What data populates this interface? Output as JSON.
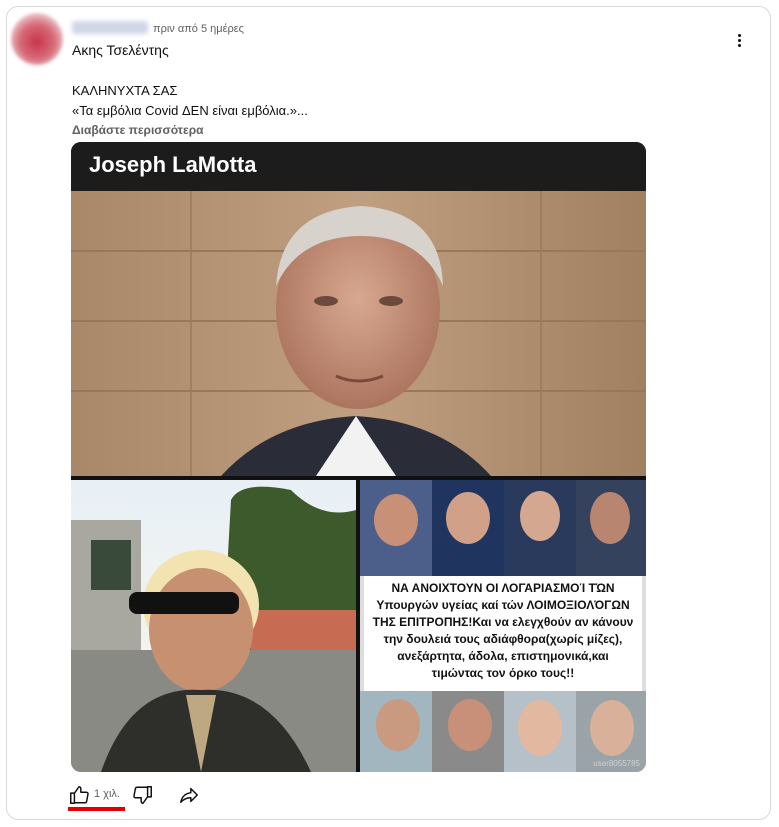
{
  "post": {
    "timestamp": "πριν από 5 ημέρες",
    "author": "Ακης Τσελέντης",
    "text_line1": "ΚΑΛΗΝΥΧΤΑ ΣΑΣ",
    "text_line2": "«Τα εμβόλια Covid ΔΕΝ είναι εμβόλια.»...",
    "read_more": "Διαβάστε περισσότερα"
  },
  "image": {
    "header_title": "Joseph LaMotta",
    "meme_lines": [
      "ΝΑ ΑΝΟΙΧΤΟΥΝ ΟΙ ΛΟΓΑΡΙΑΣΜΟΊ ΤΏΝ",
      "Υπουργών υγείας καί τών ΛΟΙΜΟΞΙΟΛΌΓΩΝ",
      "ΤΗΣ ΕΠΙΤΡΟΠΗΣ!Και να ελεγχθούν αν κάνουν",
      "την δουλειά τους αδιάφθορα(χωρίς μίζες),",
      "ανεξάρτητα, άδολα, επιστημονικά,και",
      "τιμώντας τον όρκο τους!!"
    ],
    "watermark": "user8055785"
  },
  "actions": {
    "like_count": "1 χιλ.",
    "like_icon": "thumb-up-icon",
    "dislike_icon": "thumb-down-icon",
    "share_icon": "share-icon",
    "highlight_color": "#e00000"
  }
}
